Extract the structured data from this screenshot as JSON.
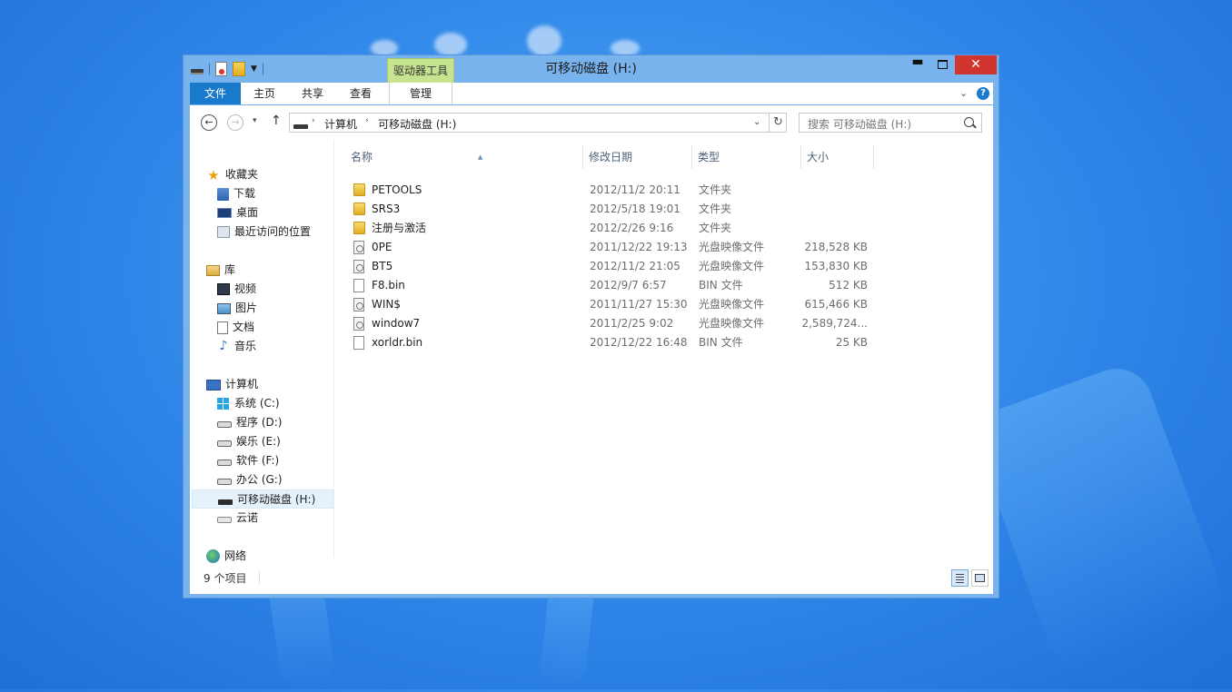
{
  "window": {
    "title": "可移动磁盘 (H:)",
    "context_tab_group": "驱动器工具",
    "controls": {
      "minimize": "▬",
      "maximize": "",
      "close": "✕"
    }
  },
  "ribbon": {
    "tabs": [
      "文件",
      "主页",
      "共享",
      "查看",
      "管理"
    ],
    "expand": "⌄",
    "help": "?"
  },
  "address": {
    "back": "←",
    "forward": "→",
    "recent": "▾",
    "up": "↑",
    "crumbs": [
      "计算机",
      "可移动磁盘 (H:)"
    ],
    "crumb_sep": "›",
    "dropdown": "⌄",
    "refresh": "↻"
  },
  "search": {
    "placeholder": "搜索 可移动磁盘 (H:)"
  },
  "nav": {
    "favorites": {
      "label": "收藏夹",
      "items": [
        "下载",
        "桌面",
        "最近访问的位置"
      ]
    },
    "libraries": {
      "label": "库",
      "items": [
        "视频",
        "图片",
        "文档",
        "音乐"
      ]
    },
    "computer": {
      "label": "计算机",
      "drives": [
        "系统 (C:)",
        "程序 (D:)",
        "娱乐 (E:)",
        "软件 (F:)",
        "办公 (G:)",
        "可移动磁盘 (H:)",
        "云诺"
      ],
      "selected": "可移动磁盘 (H:)"
    },
    "network": {
      "label": "网络"
    }
  },
  "columns": {
    "name": "名称",
    "date": "修改日期",
    "type": "类型",
    "size": "大小",
    "sort_indicator": "▲"
  },
  "files": [
    {
      "name": "PETOOLS",
      "date": "2012/11/2 20:11",
      "type": "文件夹",
      "size": "",
      "icon": "folder-icon"
    },
    {
      "name": "SRS3",
      "date": "2012/5/18 19:01",
      "type": "文件夹",
      "size": "",
      "icon": "folder-icon"
    },
    {
      "name": "注册与激活",
      "date": "2012/2/26 9:16",
      "type": "文件夹",
      "size": "",
      "icon": "folder-icon"
    },
    {
      "name": "0PE",
      "date": "2011/12/22 19:13",
      "type": "光盘映像文件",
      "size": "218,528 KB",
      "icon": "disc-image-icon"
    },
    {
      "name": "BT5",
      "date": "2012/11/2 21:05",
      "type": "光盘映像文件",
      "size": "153,830 KB",
      "icon": "disc-image-icon"
    },
    {
      "name": "F8.bin",
      "date": "2012/9/7 6:57",
      "type": "BIN 文件",
      "size": "512 KB",
      "icon": "file-icon"
    },
    {
      "name": "WIN$",
      "date": "2011/11/27 15:30",
      "type": "光盘映像文件",
      "size": "615,466 KB",
      "icon": "disc-image-icon"
    },
    {
      "name": "window7",
      "date": "2011/2/25 9:02",
      "type": "光盘映像文件",
      "size": "2,589,724...",
      "icon": "disc-image-icon"
    },
    {
      "name": "xorldr.bin",
      "date": "2012/12/22 16:48",
      "type": "BIN 文件",
      "size": "25 KB",
      "icon": "file-icon"
    }
  ],
  "status": {
    "item_count": "9 个项目"
  },
  "colors": {
    "accent": "#1979ca",
    "window_frame": "#78b3ee",
    "close": "#d0352f",
    "context_tab": "#c6e48f"
  }
}
